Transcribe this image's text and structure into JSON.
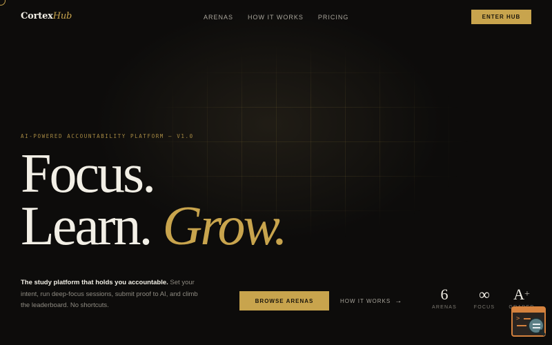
{
  "nav": {
    "logo_main": "Cortex",
    "logo_accent": "Hub",
    "links": [
      "ARENAS",
      "HOW IT WORKS",
      "PRICING"
    ],
    "cta": "ENTER HUB"
  },
  "hero": {
    "eyebrow": "AI-POWERED ACCOUNTABILITY PLATFORM — V1.0",
    "line1": "Focus.",
    "line2": "Learn.",
    "line2_accent": "Grow.",
    "desc_strong": "The study platform that holds you accountable.",
    "desc_rest": " Set your intent, run deep-focus sessions, submit proof to AI, and climb the leaderboard. No shortcuts.",
    "browse_label": "BROWSE ARENAS",
    "how_label": "HOW IT WORKS",
    "how_arrow": "→"
  },
  "stats": [
    {
      "value": "6",
      "label": "ARENAS"
    },
    {
      "value": "∞",
      "label": "FOCUS"
    },
    {
      "value": "A",
      "suffix": "+",
      "label": "GRADED"
    }
  ],
  "icons": {
    "arrow": "arrow-right-icon",
    "widget": "terminal-search-icon"
  },
  "colors": {
    "accent": "#c8a44d",
    "background": "#0d0c0b",
    "text": "#f2efe6",
    "widget_accent": "#d5823e"
  }
}
